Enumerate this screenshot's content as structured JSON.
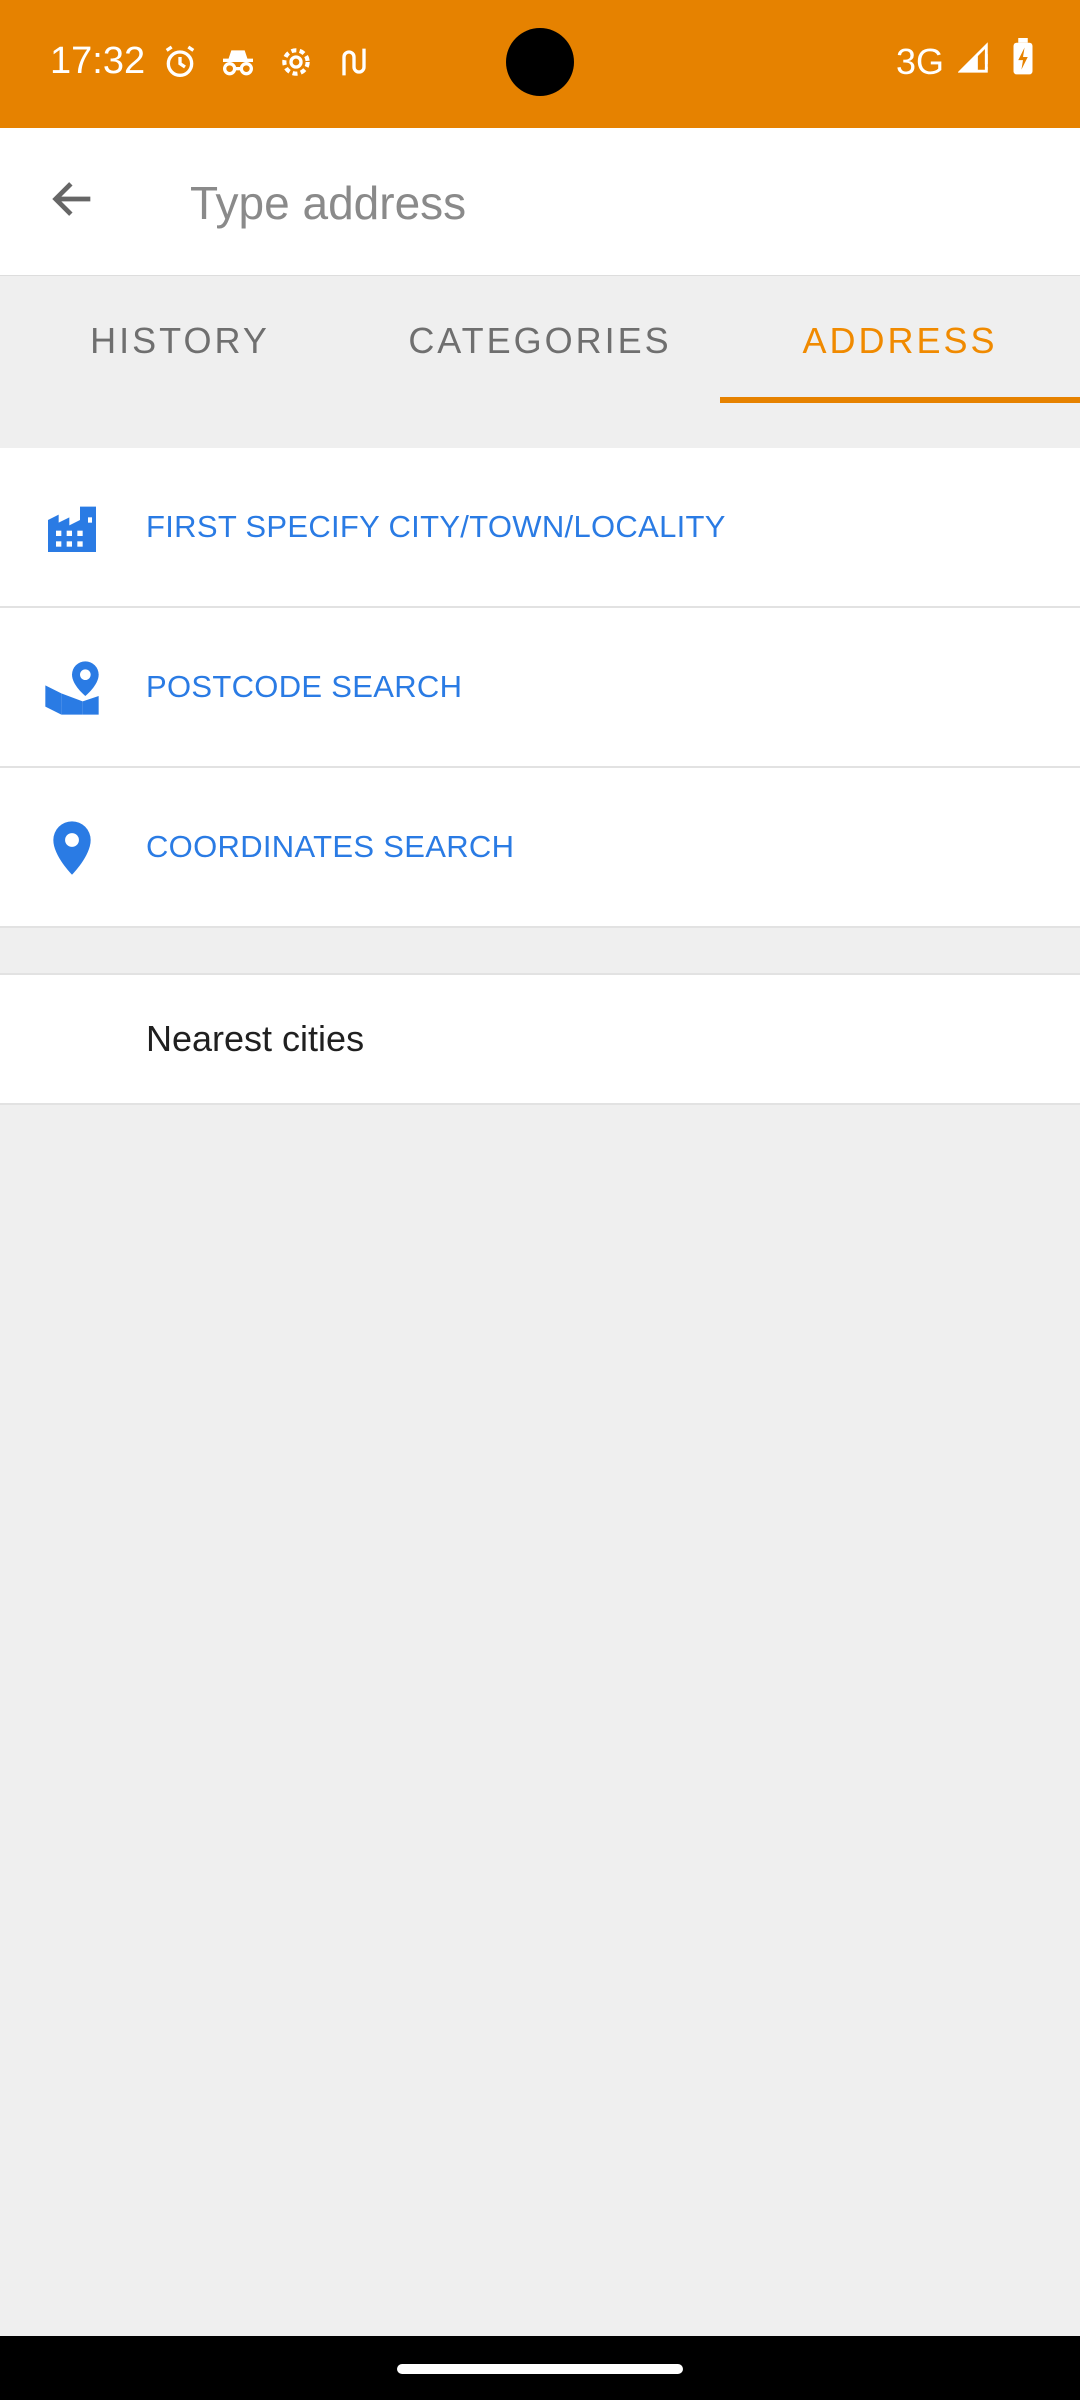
{
  "status_bar": {
    "time": "17:32",
    "network": "3G",
    "icons": [
      "alarm-icon",
      "incognito-icon",
      "settings-icon",
      "route-icon",
      "signal-icon",
      "battery-charging-icon"
    ]
  },
  "search": {
    "placeholder": "Type address",
    "value": ""
  },
  "tabs": [
    {
      "label": "HISTORY",
      "active": false
    },
    {
      "label": "CATEGORIES",
      "active": false
    },
    {
      "label": "ADDRESS",
      "active": true
    }
  ],
  "options": [
    {
      "label": "FIRST SPECIFY CITY/TOWN/LOCALITY",
      "icon": "city-icon"
    },
    {
      "label": "POSTCODE SEARCH",
      "icon": "postcode-map-icon"
    },
    {
      "label": "COORDINATES SEARCH",
      "icon": "location-pin-icon"
    }
  ],
  "nearest": {
    "label": "Nearest cities"
  },
  "colors": {
    "accent": "#e68200",
    "link": "#2a7be4",
    "background": "#efefef"
  }
}
